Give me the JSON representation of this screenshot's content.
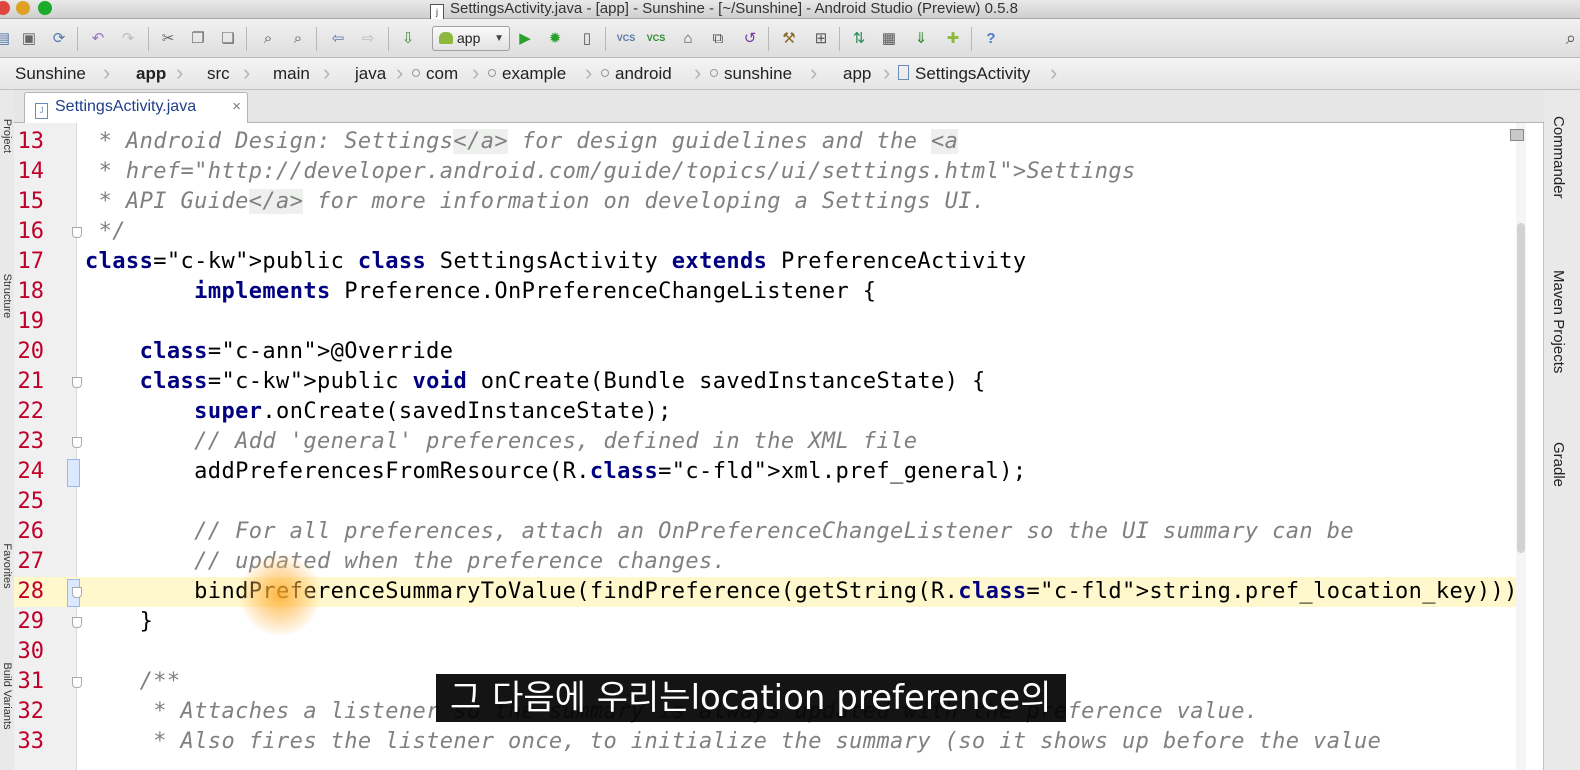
{
  "window": {
    "title": "SettingsActivity.java - [app] - Sunshine - [~/Sunshine] - Android Studio (Preview) 0.5.8",
    "file_badge": "j"
  },
  "toolbar": {
    "run_config": "app",
    "icons": [
      "save-icon",
      "sync-icon",
      "undo-icon",
      "redo-icon",
      "cut-icon",
      "copy-icon",
      "paste-icon",
      "find-icon",
      "replace-icon",
      "back-icon",
      "forward-icon",
      "make-icon",
      "run-icon",
      "debug-icon",
      "attach-icon",
      "vcs-update-icon",
      "vcs-commit-icon",
      "avd-icon",
      "sdk-icon",
      "revert-icon",
      "settings-icon",
      "structure-icon",
      "gradle-sync-icon",
      "monitor-icon",
      "sdk-manager-icon",
      "android-icon",
      "help-icon"
    ],
    "vcs_label": "VCS",
    "help_label": "?"
  },
  "breadcrumb": [
    "Sunshine",
    "app",
    "src",
    "main",
    "java",
    "com",
    "example",
    "android",
    "sunshine",
    "app",
    "SettingsActivity"
  ],
  "tab": {
    "label": "SettingsActivity.java",
    "close": "×",
    "file_badge": "J"
  },
  "left_tools": [
    "Project",
    "Structure",
    "Favorites",
    "Build Variants"
  ],
  "right_tools": [
    "Commander",
    "Maven Projects",
    "Gradle"
  ],
  "editor": {
    "current_line": 28,
    "lines": [
      {
        "n": "13",
        "t": " * Android Design: Settings</a> for design guidelines and the <a"
      },
      {
        "n": "14",
        "t": " * href=\"http://developer.android.com/guide/topics/ui/settings.html\">Settings"
      },
      {
        "n": "15",
        "t": " * API Guide</a> for more information on developing a Settings UI."
      },
      {
        "n": "16",
        "t": " */"
      },
      {
        "n": "17",
        "t": "public class SettingsActivity extends PreferenceActivity"
      },
      {
        "n": "18",
        "t": "        implements Preference.OnPreferenceChangeListener {"
      },
      {
        "n": "19",
        "t": ""
      },
      {
        "n": "20",
        "t": "    @Override"
      },
      {
        "n": "21",
        "t": "    public void onCreate(Bundle savedInstanceState) {"
      },
      {
        "n": "22",
        "t": "        super.onCreate(savedInstanceState);"
      },
      {
        "n": "23",
        "t": "        // Add 'general' preferences, defined in the XML file"
      },
      {
        "n": "24",
        "t": "        addPreferencesFromResource(R.xml.pref_general);"
      },
      {
        "n": "25",
        "t": ""
      },
      {
        "n": "26",
        "t": "        // For all preferences, attach an OnPreferenceChangeListener so the UI summary can be"
      },
      {
        "n": "27",
        "t": "        // updated when the preference changes."
      },
      {
        "n": "28",
        "t": "        bindPreferenceSummaryToValue(findPreference(getString(R.string.pref_location_key)));"
      },
      {
        "n": "29",
        "t": "    }"
      },
      {
        "n": "30",
        "t": ""
      },
      {
        "n": "31",
        "t": "    /**"
      },
      {
        "n": "32",
        "t": "     * Attaches a listener so the summary is always updated with the preference value."
      },
      {
        "n": "33",
        "t": "     * Also fires the listener once, to initialize the summary (so it shows up before the value"
      }
    ]
  },
  "subtitle": "그 다음에 우리는location preference의",
  "colors": {
    "keyword": "#000080",
    "comment": "#808080",
    "line_number": "#c0002a",
    "current_line": "#fff8cc"
  }
}
